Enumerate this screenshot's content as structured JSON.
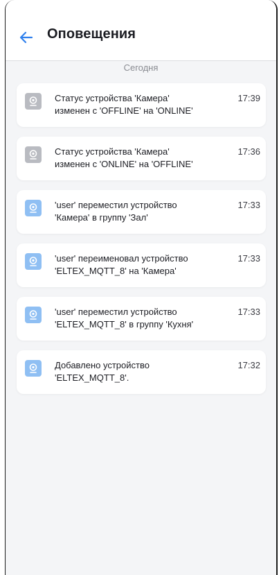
{
  "header": {
    "title": "Оповещения"
  },
  "date_label": "Сегодня",
  "notifications": [
    {
      "text": "Статус устройства 'Камера' изменен с 'OFFLINE' на 'ONLINE'",
      "time": "17:39",
      "icon": "camera-icon",
      "icon_color": "#b9bbc1"
    },
    {
      "text": "Статус устройства 'Камера' изменен с 'ONLINE' на 'OFFLINE'",
      "time": "17:36",
      "icon": "camera-icon",
      "icon_color": "#b9bbc1"
    },
    {
      "text": "'user' переместил устройство 'Камера' в группу 'Зал'",
      "time": "17:33",
      "icon": "camera-icon",
      "icon_color": "#8fbff3"
    },
    {
      "text": "'user' переименовал устройство 'ELTEX_MQTT_8' на 'Камера'",
      "time": "17:33",
      "icon": "camera-icon",
      "icon_color": "#8fbff3"
    },
    {
      "text": "'user' переместил устройство 'ELTEX_MQTT_8' в группу 'Кухня'",
      "time": "17:33",
      "icon": "camera-icon",
      "icon_color": "#8fbff3"
    },
    {
      "text": "Добавлено устройство 'ELTEX_MQTT_8'.",
      "time": "17:32",
      "icon": "camera-icon",
      "icon_color": "#8fbff3"
    }
  ],
  "colors": {
    "accent": "#2f80ed",
    "background": "#f4f5f7"
  }
}
